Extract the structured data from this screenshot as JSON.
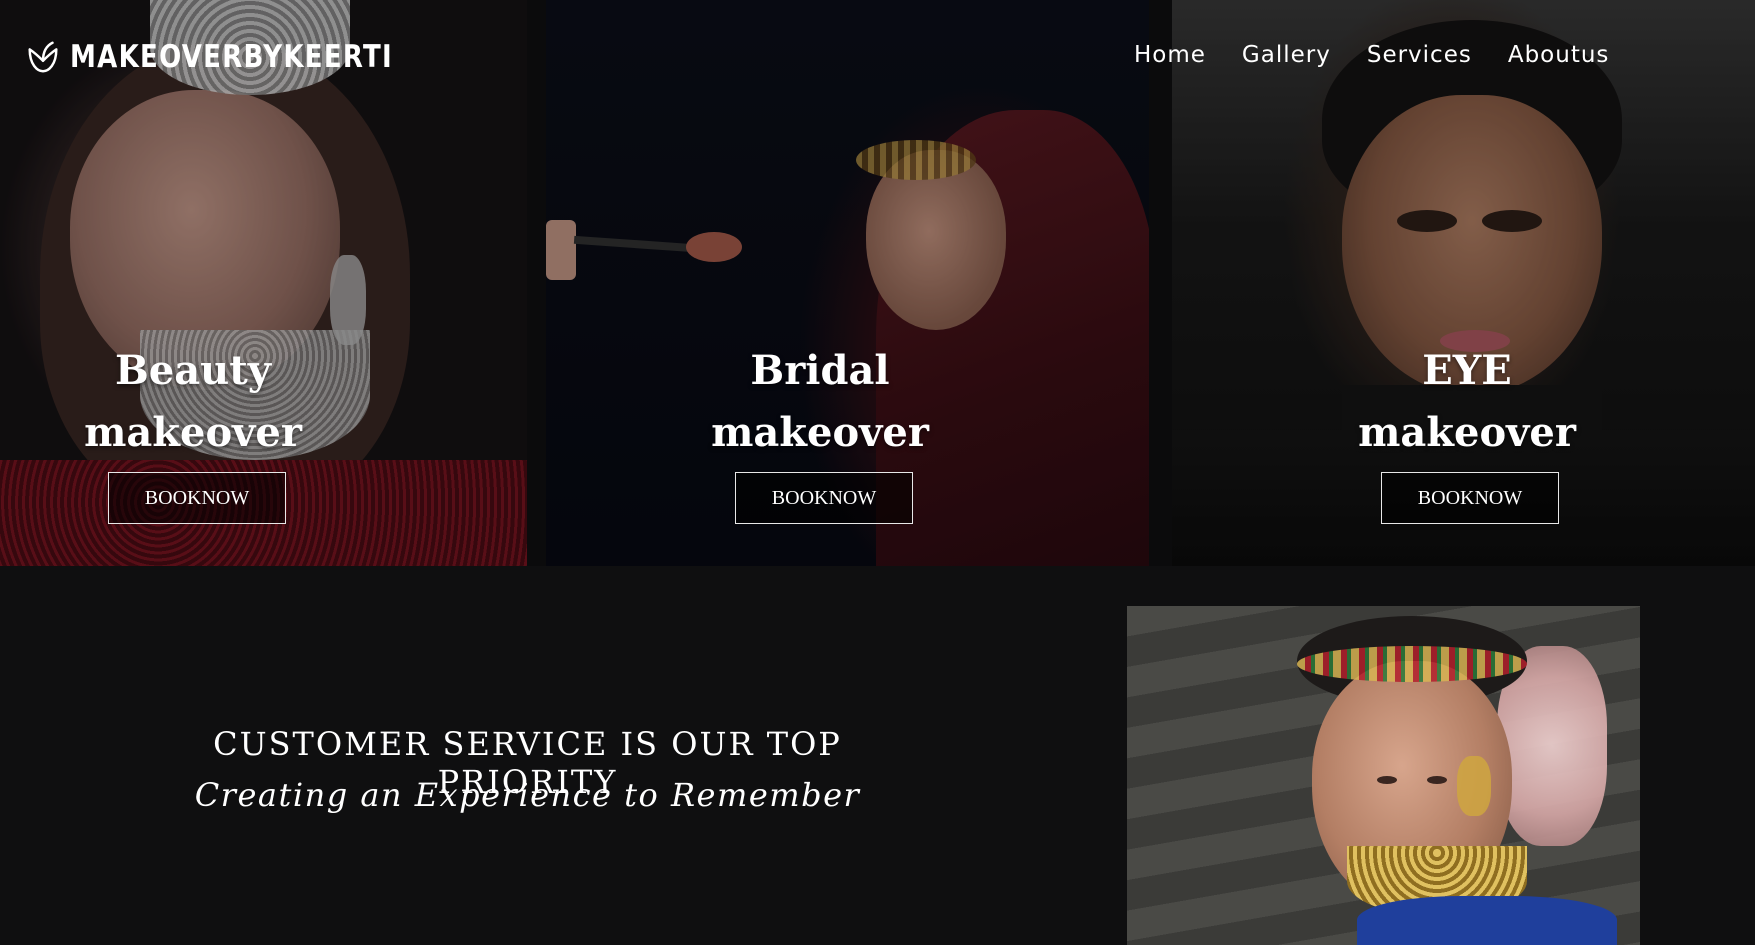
{
  "brand": {
    "name": "MAKEOVERBYKEERTI",
    "logo_icon": "lotus-icon"
  },
  "nav": {
    "items": [
      {
        "label": "Home"
      },
      {
        "label": "Gallery"
      },
      {
        "label": "Services"
      },
      {
        "label": "Aboutus"
      }
    ]
  },
  "services": [
    {
      "title_line1": "Beauty",
      "title_line2": "makeover",
      "button": "BOOKNOW"
    },
    {
      "title_line1": "Bridal",
      "title_line2": "makeover",
      "button": "BOOKNOW"
    },
    {
      "title_line1": "EYE",
      "title_line2": "makeover",
      "button": "BOOKNOW"
    }
  ],
  "promo": {
    "headline": "CUSTOMER SERVICE IS OUR TOP PRIORITY",
    "subheadline": "Creating an Experience to Remember"
  },
  "colors": {
    "background": "#0f0f10",
    "text": "#ffffff",
    "button_border": "#e8e8e8"
  }
}
